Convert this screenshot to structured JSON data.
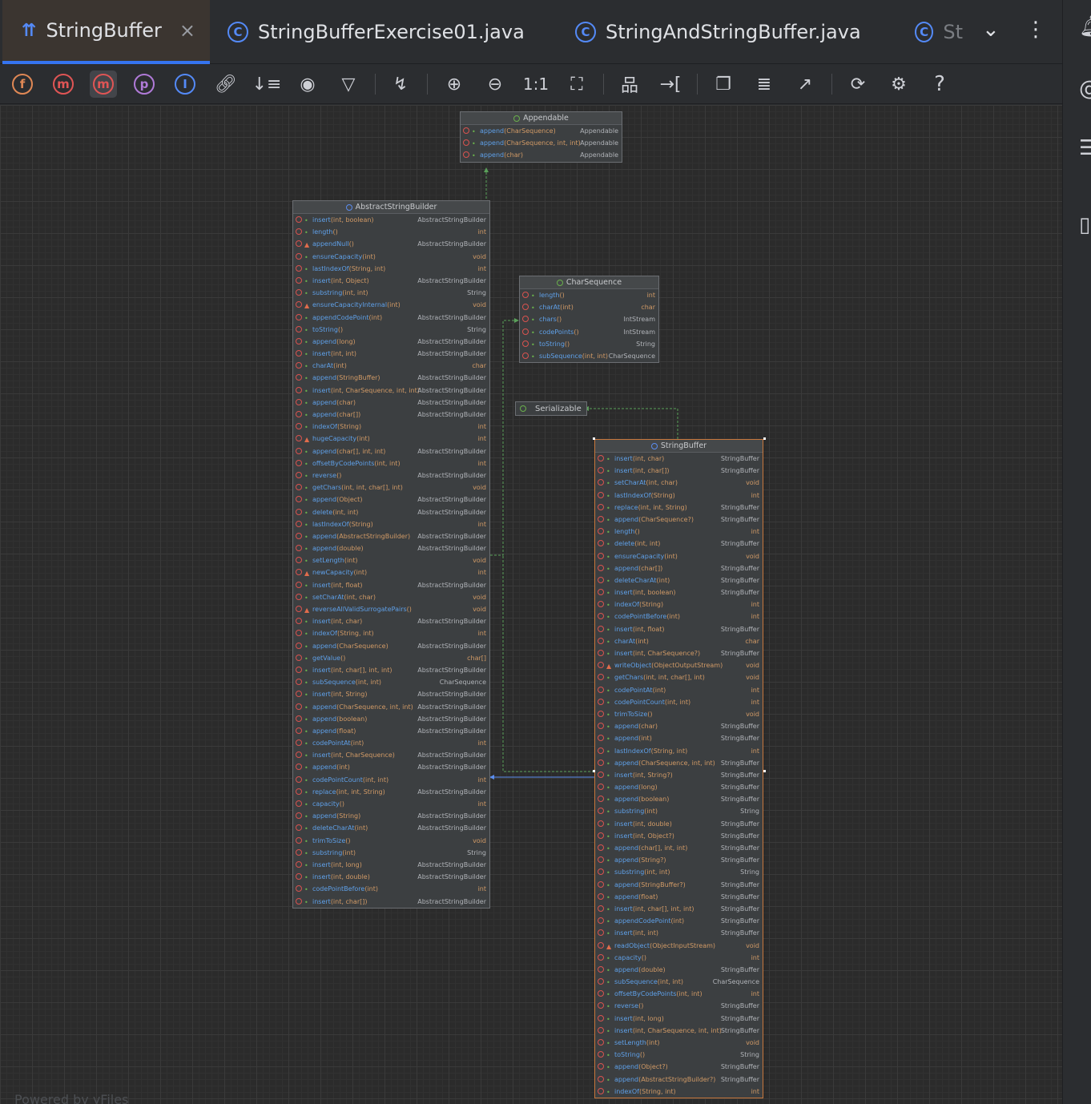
{
  "tabs": [
    {
      "label": "StringBuffer",
      "icon": "hierarchy-icon",
      "active": true
    },
    {
      "label": "StringBufferExercise01.java",
      "icon": "class-icon"
    },
    {
      "label": "StringAndStringBuffer.java",
      "icon": "class-icon"
    },
    {
      "label": "St",
      "icon": "class-icon"
    }
  ],
  "toolbar": {
    "buttons": [
      "fields-toggle",
      "methods-starred-toggle",
      "methods-toggle",
      "properties-toggle",
      "inner-classes-toggle",
      "dependencies",
      "sort",
      "visibility",
      "filter",
      "route-edges",
      "zoom-in",
      "zoom-out",
      "actual-size",
      "fit-content",
      "layout",
      "apply-layout",
      "copy",
      "export",
      "open-in-editor",
      "refresh",
      "settings",
      "help"
    ],
    "actual_size_label": "1:1",
    "help_label": "?"
  },
  "canvas": {
    "powered_by": "Powered by yFiles"
  },
  "appendable": {
    "title": "Appendable",
    "rows": [
      {
        "name": "append",
        "params": "(CharSequence)",
        "ret": "Appendable"
      },
      {
        "name": "append",
        "params": "(CharSequence, int, int)",
        "ret": "Appendable"
      },
      {
        "name": "append",
        "params": "(char)",
        "ret": "Appendable"
      }
    ]
  },
  "charsequence": {
    "title": "CharSequence",
    "rows": [
      {
        "name": "length",
        "params": "()",
        "ret": "int"
      },
      {
        "name": "charAt",
        "params": "(int)",
        "ret": "char"
      },
      {
        "name": "chars",
        "params": "()",
        "ret": "IntStream"
      },
      {
        "name": "codePoints",
        "params": "()",
        "ret": "IntStream"
      },
      {
        "name": "toString",
        "params": "()",
        "ret": "String"
      },
      {
        "name": "subSequence",
        "params": "(int, int)",
        "ret": "CharSequence"
      }
    ]
  },
  "serializable": {
    "title": "Serializable"
  },
  "abstractstringbuilder": {
    "title": "AbstractStringBuilder",
    "rows": [
      {
        "name": "insert",
        "params": "(int, boolean)",
        "ret": "AbstractStringBuilder"
      },
      {
        "name": "length",
        "params": "()",
        "ret": "int"
      },
      {
        "name": "appendNull",
        "params": "()",
        "ret": "AbstractStringBuilder",
        "priv": true
      },
      {
        "name": "ensureCapacity",
        "params": "(int)",
        "ret": "void"
      },
      {
        "name": "lastIndexOf",
        "params": "(String, int)",
        "ret": "int"
      },
      {
        "name": "insert",
        "params": "(int, Object)",
        "ret": "AbstractStringBuilder"
      },
      {
        "name": "substring",
        "params": "(int, int)",
        "ret": "String"
      },
      {
        "name": "ensureCapacityInternal",
        "params": "(int)",
        "ret": "void",
        "priv": true
      },
      {
        "name": "appendCodePoint",
        "params": "(int)",
        "ret": "AbstractStringBuilder"
      },
      {
        "name": "toString",
        "params": "()",
        "ret": "String"
      },
      {
        "name": "append",
        "params": "(long)",
        "ret": "AbstractStringBuilder"
      },
      {
        "name": "insert",
        "params": "(int, int)",
        "ret": "AbstractStringBuilder"
      },
      {
        "name": "charAt",
        "params": "(int)",
        "ret": "char"
      },
      {
        "name": "append",
        "params": "(StringBuffer)",
        "ret": "AbstractStringBuilder"
      },
      {
        "name": "insert",
        "params": "(int, CharSequence, int, int)",
        "ret": "AbstractStringBuilder"
      },
      {
        "name": "append",
        "params": "(char)",
        "ret": "AbstractStringBuilder"
      },
      {
        "name": "append",
        "params": "(char[])",
        "ret": "AbstractStringBuilder"
      },
      {
        "name": "indexOf",
        "params": "(String)",
        "ret": "int"
      },
      {
        "name": "hugeCapacity",
        "params": "(int)",
        "ret": "int",
        "priv": true
      },
      {
        "name": "append",
        "params": "(char[], int, int)",
        "ret": "AbstractStringBuilder"
      },
      {
        "name": "offsetByCodePoints",
        "params": "(int, int)",
        "ret": "int"
      },
      {
        "name": "reverse",
        "params": "()",
        "ret": "AbstractStringBuilder"
      },
      {
        "name": "getChars",
        "params": "(int, int, char[], int)",
        "ret": "void"
      },
      {
        "name": "append",
        "params": "(Object)",
        "ret": "AbstractStringBuilder"
      },
      {
        "name": "delete",
        "params": "(int, int)",
        "ret": "AbstractStringBuilder"
      },
      {
        "name": "lastIndexOf",
        "params": "(String)",
        "ret": "int"
      },
      {
        "name": "append",
        "params": "(AbstractStringBuilder)",
        "ret": "AbstractStringBuilder"
      },
      {
        "name": "append",
        "params": "(double)",
        "ret": "AbstractStringBuilder"
      },
      {
        "name": "setLength",
        "params": "(int)",
        "ret": "void"
      },
      {
        "name": "newCapacity",
        "params": "(int)",
        "ret": "int",
        "priv": true
      },
      {
        "name": "insert",
        "params": "(int, float)",
        "ret": "AbstractStringBuilder"
      },
      {
        "name": "setCharAt",
        "params": "(int, char)",
        "ret": "void"
      },
      {
        "name": "reverseAllValidSurrogatePairs",
        "params": "()",
        "ret": "void",
        "priv": true
      },
      {
        "name": "insert",
        "params": "(int, char)",
        "ret": "AbstractStringBuilder"
      },
      {
        "name": "indexOf",
        "params": "(String, int)",
        "ret": "int"
      },
      {
        "name": "append",
        "params": "(CharSequence)",
        "ret": "AbstractStringBuilder"
      },
      {
        "name": "getValue",
        "params": "()",
        "ret": "char[]"
      },
      {
        "name": "insert",
        "params": "(int, char[], int, int)",
        "ret": "AbstractStringBuilder"
      },
      {
        "name": "subSequence",
        "params": "(int, int)",
        "ret": "CharSequence"
      },
      {
        "name": "insert",
        "params": "(int, String)",
        "ret": "AbstractStringBuilder"
      },
      {
        "name": "append",
        "params": "(CharSequence, int, int)",
        "ret": "AbstractStringBuilder"
      },
      {
        "name": "append",
        "params": "(boolean)",
        "ret": "AbstractStringBuilder"
      },
      {
        "name": "append",
        "params": "(float)",
        "ret": "AbstractStringBuilder"
      },
      {
        "name": "codePointAt",
        "params": "(int)",
        "ret": "int"
      },
      {
        "name": "insert",
        "params": "(int, CharSequence)",
        "ret": "AbstractStringBuilder"
      },
      {
        "name": "append",
        "params": "(int)",
        "ret": "AbstractStringBuilder"
      },
      {
        "name": "codePointCount",
        "params": "(int, int)",
        "ret": "int"
      },
      {
        "name": "replace",
        "params": "(int, int, String)",
        "ret": "AbstractStringBuilder"
      },
      {
        "name": "capacity",
        "params": "()",
        "ret": "int"
      },
      {
        "name": "append",
        "params": "(String)",
        "ret": "AbstractStringBuilder"
      },
      {
        "name": "deleteCharAt",
        "params": "(int)",
        "ret": "AbstractStringBuilder"
      },
      {
        "name": "trimToSize",
        "params": "()",
        "ret": "void"
      },
      {
        "name": "substring",
        "params": "(int)",
        "ret": "String"
      },
      {
        "name": "insert",
        "params": "(int, long)",
        "ret": "AbstractStringBuilder"
      },
      {
        "name": "insert",
        "params": "(int, double)",
        "ret": "AbstractStringBuilder"
      },
      {
        "name": "codePointBefore",
        "params": "(int)",
        "ret": "int"
      },
      {
        "name": "insert",
        "params": "(int, char[])",
        "ret": "AbstractStringBuilder"
      }
    ]
  },
  "stringbuffer": {
    "title": "StringBuffer",
    "rows": [
      {
        "name": "insert",
        "params": "(int, char)",
        "ret": "StringBuffer"
      },
      {
        "name": "insert",
        "params": "(int, char[])",
        "ret": "StringBuffer"
      },
      {
        "name": "setCharAt",
        "params": "(int, char)",
        "ret": "void"
      },
      {
        "name": "lastIndexOf",
        "params": "(String)",
        "ret": "int"
      },
      {
        "name": "replace",
        "params": "(int, int, String)",
        "ret": "StringBuffer"
      },
      {
        "name": "append",
        "params": "(CharSequence?)",
        "ret": "StringBuffer"
      },
      {
        "name": "length",
        "params": "()",
        "ret": "int"
      },
      {
        "name": "delete",
        "params": "(int, int)",
        "ret": "StringBuffer"
      },
      {
        "name": "ensureCapacity",
        "params": "(int)",
        "ret": "void"
      },
      {
        "name": "append",
        "params": "(char[])",
        "ret": "StringBuffer"
      },
      {
        "name": "deleteCharAt",
        "params": "(int)",
        "ret": "StringBuffer"
      },
      {
        "name": "insert",
        "params": "(int, boolean)",
        "ret": "StringBuffer"
      },
      {
        "name": "indexOf",
        "params": "(String)",
        "ret": "int"
      },
      {
        "name": "codePointBefore",
        "params": "(int)",
        "ret": "int"
      },
      {
        "name": "insert",
        "params": "(int, float)",
        "ret": "StringBuffer"
      },
      {
        "name": "charAt",
        "params": "(int)",
        "ret": "char"
      },
      {
        "name": "insert",
        "params": "(int, CharSequence?)",
        "ret": "StringBuffer"
      },
      {
        "name": "writeObject",
        "params": "(ObjectOutputStream)",
        "ret": "void",
        "priv": true
      },
      {
        "name": "getChars",
        "params": "(int, int, char[], int)",
        "ret": "void"
      },
      {
        "name": "codePointAt",
        "params": "(int)",
        "ret": "int"
      },
      {
        "name": "codePointCount",
        "params": "(int, int)",
        "ret": "int"
      },
      {
        "name": "trimToSize",
        "params": "()",
        "ret": "void"
      },
      {
        "name": "append",
        "params": "(char)",
        "ret": "StringBuffer"
      },
      {
        "name": "append",
        "params": "(int)",
        "ret": "StringBuffer"
      },
      {
        "name": "lastIndexOf",
        "params": "(String, int)",
        "ret": "int"
      },
      {
        "name": "append",
        "params": "(CharSequence, int, int)",
        "ret": "StringBuffer"
      },
      {
        "name": "insert",
        "params": "(int, String?)",
        "ret": "StringBuffer"
      },
      {
        "name": "append",
        "params": "(long)",
        "ret": "StringBuffer"
      },
      {
        "name": "append",
        "params": "(boolean)",
        "ret": "StringBuffer"
      },
      {
        "name": "substring",
        "params": "(int)",
        "ret": "String"
      },
      {
        "name": "insert",
        "params": "(int, double)",
        "ret": "StringBuffer"
      },
      {
        "name": "insert",
        "params": "(int, Object?)",
        "ret": "StringBuffer"
      },
      {
        "name": "append",
        "params": "(char[], int, int)",
        "ret": "StringBuffer"
      },
      {
        "name": "append",
        "params": "(String?)",
        "ret": "StringBuffer"
      },
      {
        "name": "substring",
        "params": "(int, int)",
        "ret": "String"
      },
      {
        "name": "append",
        "params": "(StringBuffer?)",
        "ret": "StringBuffer"
      },
      {
        "name": "append",
        "params": "(float)",
        "ret": "StringBuffer"
      },
      {
        "name": "insert",
        "params": "(int, char[], int, int)",
        "ret": "StringBuffer"
      },
      {
        "name": "appendCodePoint",
        "params": "(int)",
        "ret": "StringBuffer"
      },
      {
        "name": "insert",
        "params": "(int, int)",
        "ret": "StringBuffer"
      },
      {
        "name": "readObject",
        "params": "(ObjectInputStream)",
        "ret": "void",
        "priv": true
      },
      {
        "name": "capacity",
        "params": "()",
        "ret": "int"
      },
      {
        "name": "append",
        "params": "(double)",
        "ret": "StringBuffer"
      },
      {
        "name": "subSequence",
        "params": "(int, int)",
        "ret": "CharSequence"
      },
      {
        "name": "offsetByCodePoints",
        "params": "(int, int)",
        "ret": "int"
      },
      {
        "name": "reverse",
        "params": "()",
        "ret": "StringBuffer"
      },
      {
        "name": "insert",
        "params": "(int, long)",
        "ret": "StringBuffer"
      },
      {
        "name": "insert",
        "params": "(int, CharSequence, int, int)",
        "ret": "StringBuffer"
      },
      {
        "name": "setLength",
        "params": "(int)",
        "ret": "void"
      },
      {
        "name": "toString",
        "params": "()",
        "ret": "String"
      },
      {
        "name": "append",
        "params": "(Object?)",
        "ret": "StringBuffer"
      },
      {
        "name": "append",
        "params": "(AbstractStringBuilder?)",
        "ret": "StringBuffer"
      },
      {
        "name": "indexOf",
        "params": "(String, int)",
        "ret": "int"
      }
    ]
  }
}
